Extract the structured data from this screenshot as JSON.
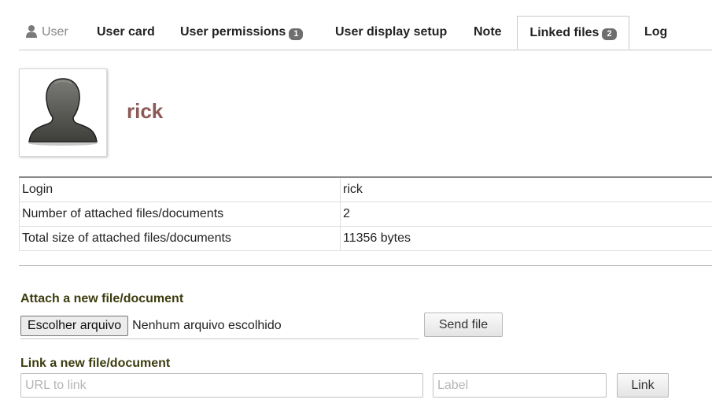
{
  "tabs": {
    "user": "User",
    "user_card": "User card",
    "user_permissions": "User permissions",
    "user_permissions_badge": "1",
    "user_display_setup": "User display setup",
    "note": "Note",
    "linked_files": "Linked files",
    "linked_files_badge": "2",
    "log": "Log"
  },
  "profile": {
    "username": "rick"
  },
  "info": [
    {
      "label": "Login",
      "value": "rick"
    },
    {
      "label": "Number of attached files/documents",
      "value": "2"
    },
    {
      "label": "Total size of attached files/documents",
      "value": "11356 bytes"
    }
  ],
  "attach": {
    "title": "Attach a new file/document",
    "choose_label": "Escolher arquivo",
    "no_file": "Nenhum arquivo escolhido",
    "send_label": "Send file"
  },
  "link": {
    "title": "Link a new file/document",
    "url_placeholder": "URL to link",
    "label_placeholder": "Label",
    "link_label": "Link"
  },
  "colors": {
    "username": "#8b5a56",
    "badge": "#6e6e6e",
    "section_title": "#3d3d10"
  },
  "icons": [
    "user-icon",
    "avatar-silhouette-icon"
  ]
}
